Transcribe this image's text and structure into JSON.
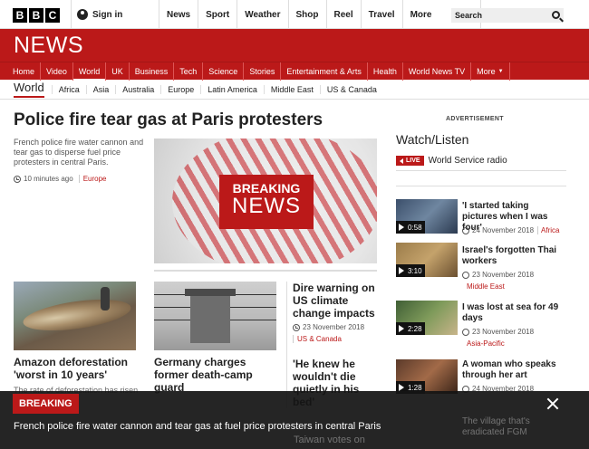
{
  "topbar": {
    "logo_letters": [
      "B",
      "B",
      "C"
    ],
    "signin_label": "Sign in",
    "nav": [
      "News",
      "Sport",
      "Weather",
      "Shop",
      "Reel",
      "Travel"
    ],
    "more_label": "More",
    "search_placeholder": "Search"
  },
  "masthead": {
    "title": "NEWS",
    "brand_color": "#bb1919"
  },
  "nav": {
    "items": [
      "Home",
      "Video",
      "World",
      "UK",
      "Business",
      "Tech",
      "Science",
      "Stories",
      "Entertainment & Arts",
      "Health",
      "World News TV",
      "More"
    ],
    "active": "World"
  },
  "subnav": {
    "section": "World",
    "items": [
      "Africa",
      "Asia",
      "Australia",
      "Europe",
      "Latin America",
      "Middle East",
      "US & Canada"
    ]
  },
  "main_story": {
    "headline": "Police fire tear gas at Paris protesters",
    "summary": "French police fire water cannon and tear gas to disperse fuel price protesters in central Paris.",
    "time": "10 minutes ago",
    "tag": "Europe",
    "image_text_1": "BREAKING",
    "image_text_2": "NEWS"
  },
  "secondary": [
    {
      "headline": "Amazon deforestation 'worst in 10 years'",
      "summary": "The rate of deforestation has risen"
    },
    {
      "headline": "Germany charges former death-camp guard"
    }
  ],
  "third_col": [
    {
      "headline": "Dire warning on US climate change impacts",
      "date": "23 November 2018",
      "tag": "US & Canada"
    },
    {
      "headline": "'He knew he wouldn't die quietly in his bed'"
    }
  ],
  "right": {
    "advert_label": "ADVERTISEMENT",
    "watch_title": "Watch/Listen",
    "live_label": "LIVE",
    "live_text": "World Service radio",
    "videos": [
      {
        "title": "'I started taking pictures when I was four'",
        "duration": "0:58",
        "date": "24 November 2018",
        "tag": "Africa"
      },
      {
        "title": "Israel's forgotten Thai workers",
        "duration": "3:10",
        "date": "23 November 2018",
        "tag": "Middle East"
      },
      {
        "title": "I was lost at sea for 49 days",
        "duration": "2:28",
        "date": "23 November 2018",
        "tag": "Asia-Pacific"
      },
      {
        "title": "A woman who speaks through her art",
        "duration": "1:28",
        "date": "24 November 2018"
      }
    ]
  },
  "banner": {
    "label": "BREAKING",
    "text": "French police fire water cannon and tear gas at fuel price protesters in central Paris",
    "under_text_1": "The village that's eradicated FGM",
    "under_text_2": "Taiwan votes on"
  }
}
